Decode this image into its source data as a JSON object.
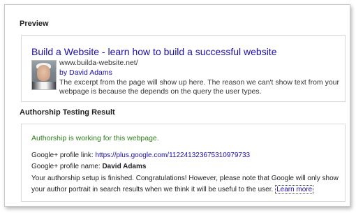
{
  "preview": {
    "section_title": "Preview",
    "result_title": "Build a Website - learn how to build a successful website",
    "url": "www.builda-website.net/",
    "author_byline": "by David Adams",
    "snippet": "The excerpt from the page will show up here. The reason we can't show text from your webpage is because the depends on the query the user types.",
    "author_photo_icon": "author-portrait"
  },
  "result": {
    "section_title": "Authorship Testing Result",
    "status": "Authorship is working for this webpage.",
    "profile_link_label": "Google+ profile link:",
    "profile_link_url": "https://plus.google.com/112241323675310979733",
    "profile_name_label": "Google+ profile name:",
    "profile_name": "David Adams",
    "message": "Your authorship setup is finished. Congratulations! However, please note that Google will only show your author portrait in search results when we think it will be useful to the user.",
    "learn_more": "Learn more"
  },
  "colors": {
    "link": "#1a0dab",
    "success": "#2e7d1a",
    "border": "#dadada"
  }
}
